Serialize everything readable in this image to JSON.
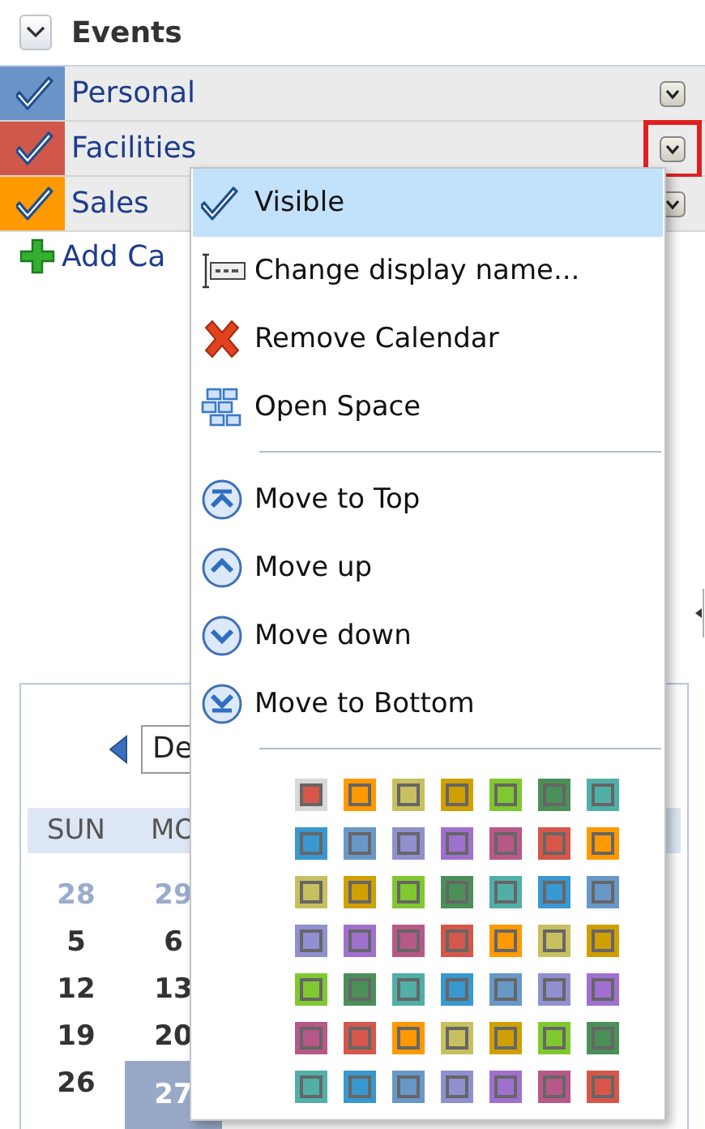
{
  "events": {
    "title": "Events",
    "expanded": true,
    "calendars": [
      {
        "name": "Personal",
        "color": "#6a94c8",
        "visible": true,
        "menu_open": false
      },
      {
        "name": "Facilities",
        "color": "#d0584a",
        "visible": true,
        "menu_open": true
      },
      {
        "name": "Sales",
        "color": "#ff9900",
        "visible": true,
        "menu_open": false
      }
    ],
    "add_label": "Add Ca"
  },
  "mini_calendar": {
    "month_field": "De",
    "weekdays": [
      "SUN",
      "MO"
    ],
    "weeks": [
      [
        {
          "text": "28",
          "muted": true,
          "selected": false
        },
        {
          "text": "29",
          "muted": true,
          "selected": false
        }
      ],
      [
        {
          "text": "5",
          "muted": false,
          "selected": false
        },
        {
          "text": "6",
          "muted": false,
          "selected": false
        }
      ],
      [
        {
          "text": "12",
          "muted": false,
          "selected": false
        },
        {
          "text": "13",
          "muted": false,
          "selected": false
        }
      ],
      [
        {
          "text": "19",
          "muted": false,
          "selected": false
        },
        {
          "text": "20",
          "muted": false,
          "selected": false
        }
      ],
      [
        {
          "text": "26",
          "muted": false,
          "selected": false
        },
        {
          "text": "27",
          "muted": false,
          "selected": true
        }
      ]
    ]
  },
  "context_menu": {
    "groups": [
      [
        {
          "kind": "check",
          "label": "Visible",
          "checked": true,
          "selected": true
        },
        {
          "kind": "rename",
          "label": "Change display name...",
          "selected": false
        },
        {
          "kind": "remove",
          "label": "Remove Calendar",
          "selected": false
        },
        {
          "kind": "open",
          "label": "Open Space",
          "selected": false
        }
      ],
      [
        {
          "kind": "top",
          "label": "Move to Top",
          "selected": false
        },
        {
          "kind": "up",
          "label": "Move up",
          "selected": false
        },
        {
          "kind": "down",
          "label": "Move down",
          "selected": false
        },
        {
          "kind": "bottom",
          "label": "Move to Bottom",
          "selected": false
        }
      ]
    ],
    "swatches": [
      {
        "color": "#d6574a",
        "selected": true
      },
      {
        "color": "#ff9900",
        "selected": false
      },
      {
        "color": "#c8c060",
        "selected": false
      },
      {
        "color": "#d0a000",
        "selected": false
      },
      {
        "color": "#80c830",
        "selected": false
      },
      {
        "color": "#4a9058",
        "selected": false
      },
      {
        "color": "#50b0a8",
        "selected": false
      },
      {
        "color": "#3898d0",
        "selected": false
      },
      {
        "color": "#6898c8",
        "selected": false
      },
      {
        "color": "#9090d0",
        "selected": false
      },
      {
        "color": "#a070d0",
        "selected": false
      },
      {
        "color": "#b85888",
        "selected": false
      },
      {
        "color": "#d6574a",
        "selected": false
      },
      {
        "color": "#ff9900",
        "selected": false
      },
      {
        "color": "#c8c060",
        "selected": false
      },
      {
        "color": "#d0a000",
        "selected": false
      },
      {
        "color": "#80c830",
        "selected": false
      },
      {
        "color": "#4a9058",
        "selected": false
      },
      {
        "color": "#50b0a8",
        "selected": false
      },
      {
        "color": "#3898d0",
        "selected": false
      },
      {
        "color": "#6898c8",
        "selected": false
      },
      {
        "color": "#9090d0",
        "selected": false
      },
      {
        "color": "#a070d0",
        "selected": false
      },
      {
        "color": "#b85888",
        "selected": false
      },
      {
        "color": "#d6574a",
        "selected": false
      },
      {
        "color": "#ff9900",
        "selected": false
      },
      {
        "color": "#c8c060",
        "selected": false
      },
      {
        "color": "#d0a000",
        "selected": false
      },
      {
        "color": "#80c830",
        "selected": false
      },
      {
        "color": "#4a9058",
        "selected": false
      },
      {
        "color": "#50b0a8",
        "selected": false
      },
      {
        "color": "#3898d0",
        "selected": false
      },
      {
        "color": "#6898c8",
        "selected": false
      },
      {
        "color": "#9090d0",
        "selected": false
      },
      {
        "color": "#a070d0",
        "selected": false
      },
      {
        "color": "#b85888",
        "selected": false
      },
      {
        "color": "#d6574a",
        "selected": false
      },
      {
        "color": "#ff9900",
        "selected": false
      },
      {
        "color": "#c8c060",
        "selected": false
      },
      {
        "color": "#d0a000",
        "selected": false
      },
      {
        "color": "#80c830",
        "selected": false
      },
      {
        "color": "#4a9058",
        "selected": false
      },
      {
        "color": "#50b0a8",
        "selected": false
      },
      {
        "color": "#3898d0",
        "selected": false
      },
      {
        "color": "#6898c8",
        "selected": false
      },
      {
        "color": "#9090d0",
        "selected": false
      },
      {
        "color": "#a070d0",
        "selected": false
      },
      {
        "color": "#b85888",
        "selected": false
      },
      {
        "color": "#d6574a",
        "selected": false
      }
    ]
  }
}
